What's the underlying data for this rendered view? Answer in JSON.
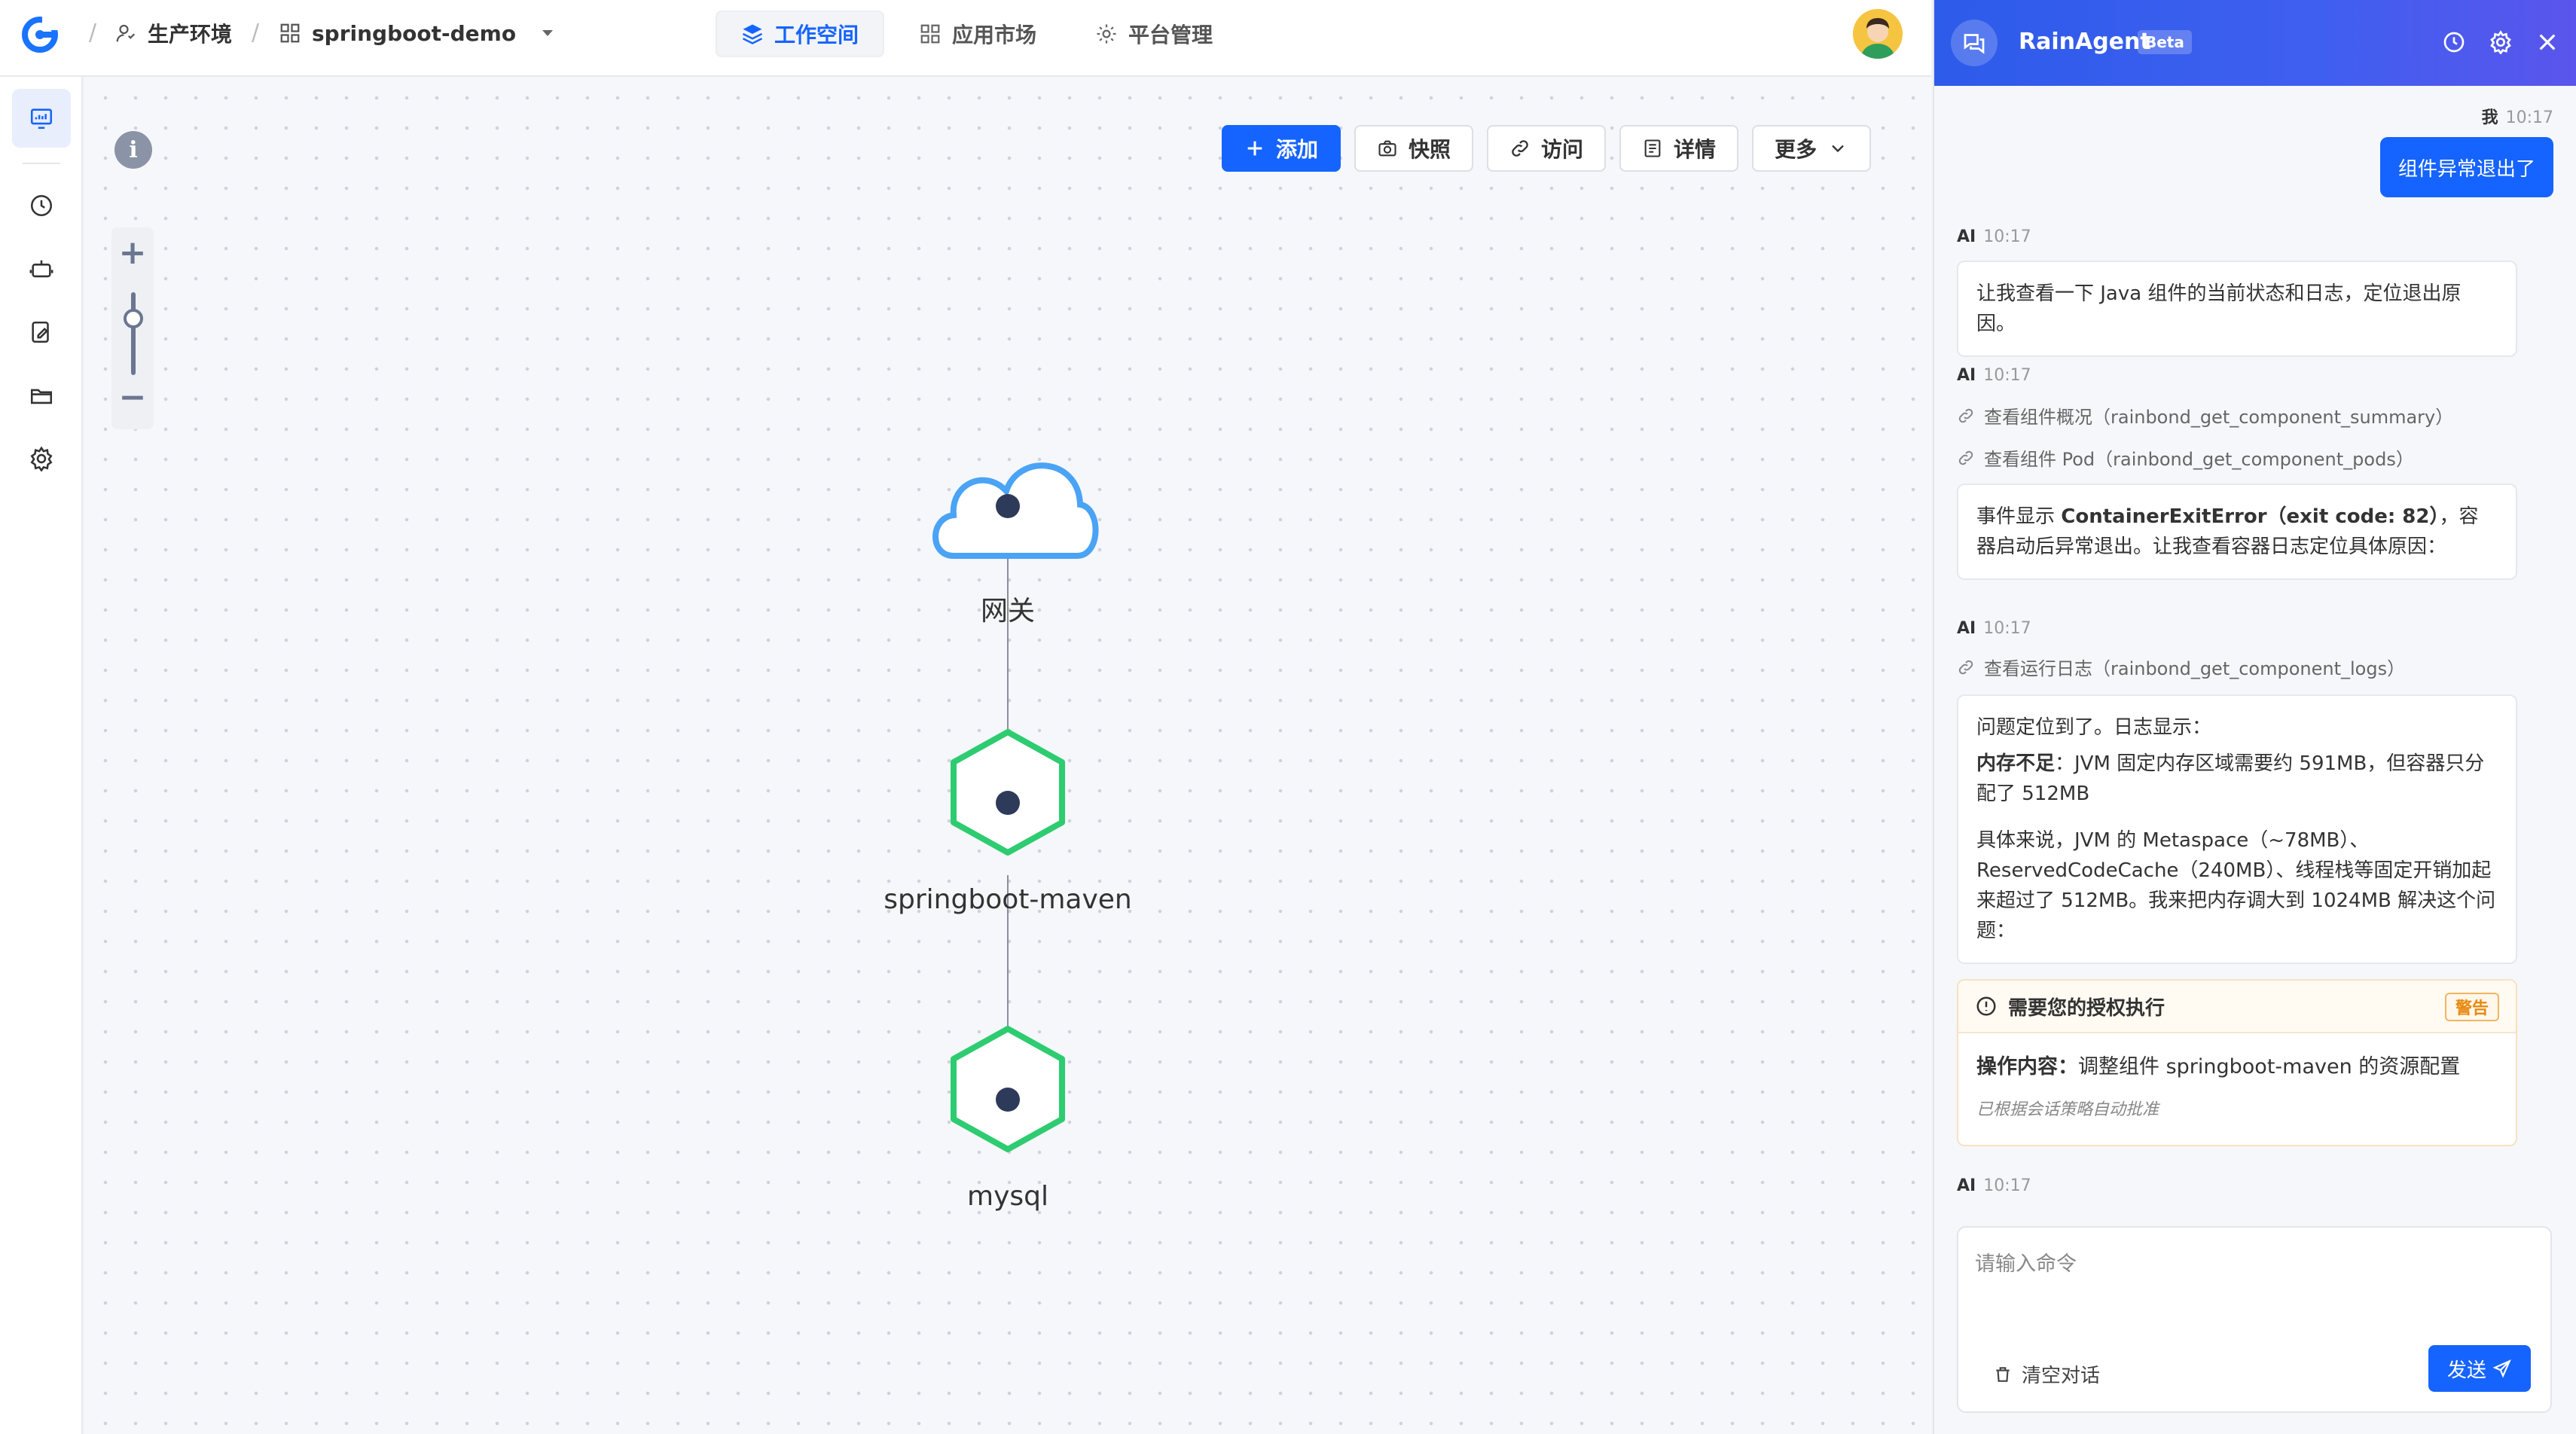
{
  "topbar": {
    "env_label": "生产环境",
    "app_label": "springboot-demo",
    "nav": [
      {
        "label": "工作空间",
        "active": true
      },
      {
        "label": "应用市场",
        "active": false
      },
      {
        "label": "平台管理",
        "active": false
      }
    ]
  },
  "sidebar": {
    "items": [
      "monitor-icon",
      "clock-icon",
      "robot-icon",
      "edit-doc-icon",
      "folder-icon",
      "gear-icon"
    ]
  },
  "canvas": {
    "info_glyph": "i",
    "zoom": {
      "plus": "+",
      "minus": "−"
    },
    "toolbar": {
      "add": "添加",
      "snapshot": "快照",
      "visit": "访问",
      "detail": "详情",
      "more": "更多"
    },
    "nodes": [
      {
        "name": "网关",
        "shape": "cloud"
      },
      {
        "name": "springboot-maven",
        "shape": "hexagon"
      },
      {
        "name": "mysql",
        "shape": "hexagon"
      }
    ],
    "colors": {
      "cloud": "#4aa3f5",
      "hexagon": "#2ecc71",
      "accent": "#1664ff"
    }
  },
  "panel": {
    "title": "RainAgent",
    "beta": "Beta",
    "messages": {
      "user_sender": "我",
      "user_time": "10:17",
      "user_text": "组件异常退出了",
      "ai_sender": "AI",
      "ai_time": "10:17",
      "ai1_text": "让我查看一下 Java 组件的当前状态和日志，定位退出原因。",
      "tool1": "查看组件概况（rainbond_get_component_summary）",
      "tool2": "查看组件 Pod（rainbond_get_component_pods）",
      "ai2_pre": "事件显示 ",
      "ai2_bold": "ContainerExitError（exit code: 82）",
      "ai2_post": "，容器启动后异常退出。让我查看容器日志定位具体原因：",
      "tool3": "查看运行日志（rainbond_get_component_logs）",
      "ai3_line1": "问题定位到了。日志显示：",
      "ai3_bold": "内存不足",
      "ai3_line2": "：JVM 固定内存区域需要约 591MB，但容器只分配了 512MB",
      "ai3_line3": "具体来说，JVM 的 Metaspace（~78MB）、ReservedCodeCache（240MB）、线程栈等固定开销加起来超过了 512MB。我来把内存调大到 1024MB 解决这个问题："
    },
    "auth": {
      "title": "需要您的授权执行",
      "tag": "警告",
      "op_label": "操作内容：",
      "op_text": "调整组件 springboot-maven 的资源配置",
      "note": "已根据会话策略自动批准"
    },
    "input": {
      "placeholder": "请输入命令",
      "clear": "清空对话",
      "send": "发送"
    }
  }
}
